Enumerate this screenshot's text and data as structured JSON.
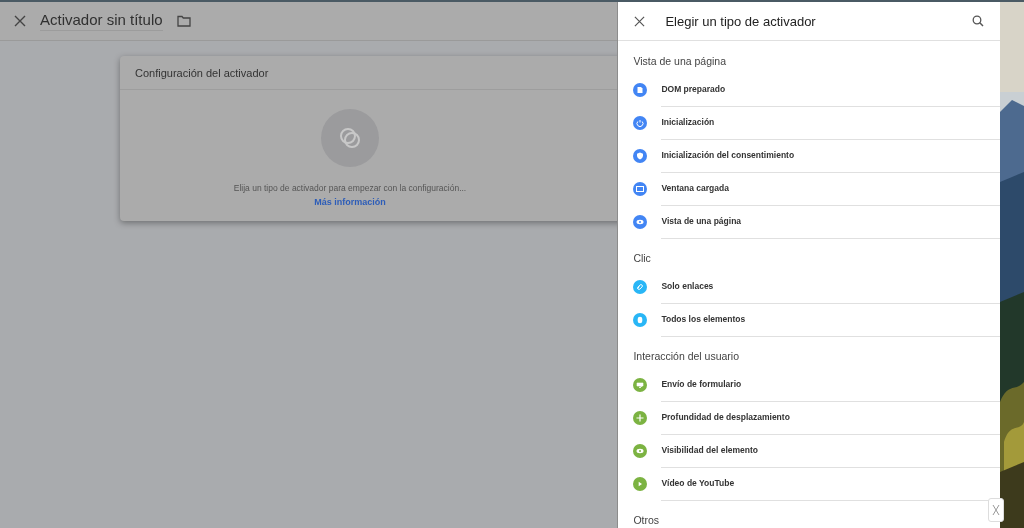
{
  "editor": {
    "title": "Activador sin título",
    "card": {
      "title": "Configuración del activador",
      "message": "Elija un tipo de activador para empezar con la configuración...",
      "link": "Más información"
    }
  },
  "panel": {
    "title": "Elegir un tipo de activador",
    "sections": [
      {
        "heading": "Vista de una página",
        "items": [
          {
            "label": "DOM preparado",
            "color": "#4285f4"
          },
          {
            "label": "Inicialización",
            "color": "#4285f4"
          },
          {
            "label": "Inicialización del consentimiento",
            "color": "#4285f4"
          },
          {
            "label": "Ventana cargada",
            "color": "#4285f4"
          },
          {
            "label": "Vista de una página",
            "color": "#4285f4"
          }
        ]
      },
      {
        "heading": "Clic",
        "items": [
          {
            "label": "Solo enlaces",
            "color": "#29b6f6"
          },
          {
            "label": "Todos los elementos",
            "color": "#29b6f6"
          }
        ]
      },
      {
        "heading": "Interacción del usuario",
        "items": [
          {
            "label": "Envío de formulario",
            "color": "#7cb342"
          },
          {
            "label": "Profundidad de desplazamiento",
            "color": "#7cb342"
          },
          {
            "label": "Visibilidad del elemento",
            "color": "#7cb342"
          },
          {
            "label": "Vídeo de YouTube",
            "color": "#7cb342"
          }
        ]
      },
      {
        "heading": "Otros"
      }
    ]
  }
}
